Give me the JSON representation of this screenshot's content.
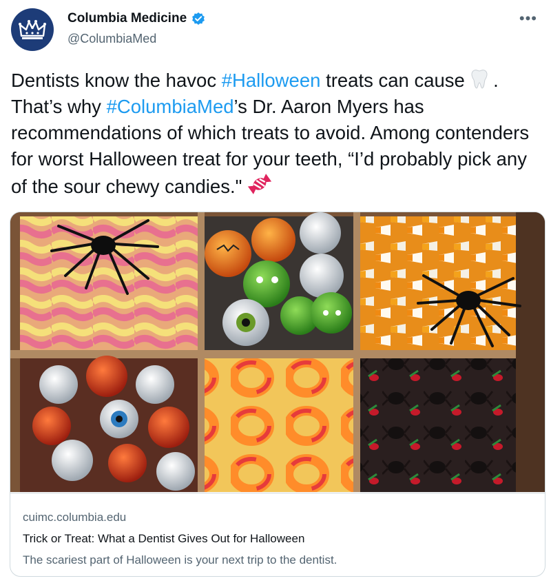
{
  "author": {
    "name": "Columbia Medicine",
    "handle": "@ColumbiaMed",
    "verified": true,
    "avatar_icon": "columbia-crown-logo",
    "avatar_color": "#1d3c78"
  },
  "more_icon": "more-options-icon",
  "tweet": {
    "seg1": "Dentists know the havoc ",
    "hashtag1": "#Halloween",
    "seg2": " treats can cause ",
    "tooth_emoji": "tooth-emoji",
    "seg3": " . That’s why ",
    "hashtag2": "#ColumbiaMed",
    "seg4": "’s Dr. Aaron Myers has recommendations of which treats to avoid. Among contenders for worst Halloween treat for your teeth, “I’d probably pick any of the sour chewy candies.\" ",
    "candy_emoji": "candy-emoji",
    "hashtag_color": "#1d9bf0"
  },
  "card": {
    "image_alt_icon": "halloween-candy-tray-image",
    "domain": "cuimc.columbia.edu",
    "title": "Trick or Treat: What a Dentist Gives Out for Halloween",
    "description": "The scariest part of Halloween is your next trip to the dentist."
  }
}
